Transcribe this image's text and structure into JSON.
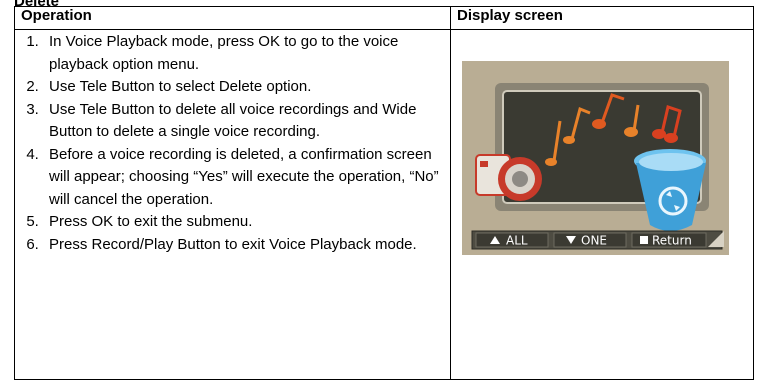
{
  "header_cut": "Delete",
  "columns": {
    "operation": "Operation",
    "display": "Display screen"
  },
  "steps": [
    "In Voice Playback mode, press OK to go to the voice playback option menu.",
    "Use Tele Button to select Delete option.",
    "Use Tele Button to delete all voice recordings and Wide Button to delete a single voice recording.",
    "Before a voice recording is deleted, a confirmation screen will appear; choosing “Yes” will execute the operation, “No” will cancel the operation.",
    "Press OK to exit the submenu.",
    "Press Record/Play Button to exit Voice Playback mode."
  ],
  "screen": {
    "buttons": [
      {
        "icon": "triangle-up-icon",
        "label": "ALL"
      },
      {
        "icon": "triangle-down-icon",
        "label": "ONE"
      },
      {
        "icon": "square-icon",
        "label": "Return"
      }
    ],
    "colors": {
      "frame": "#b9ad94",
      "panel": "#3a3a32",
      "bar": "#4e4c42",
      "notes": "#e8822a",
      "bin": "#3fa0d8"
    }
  }
}
